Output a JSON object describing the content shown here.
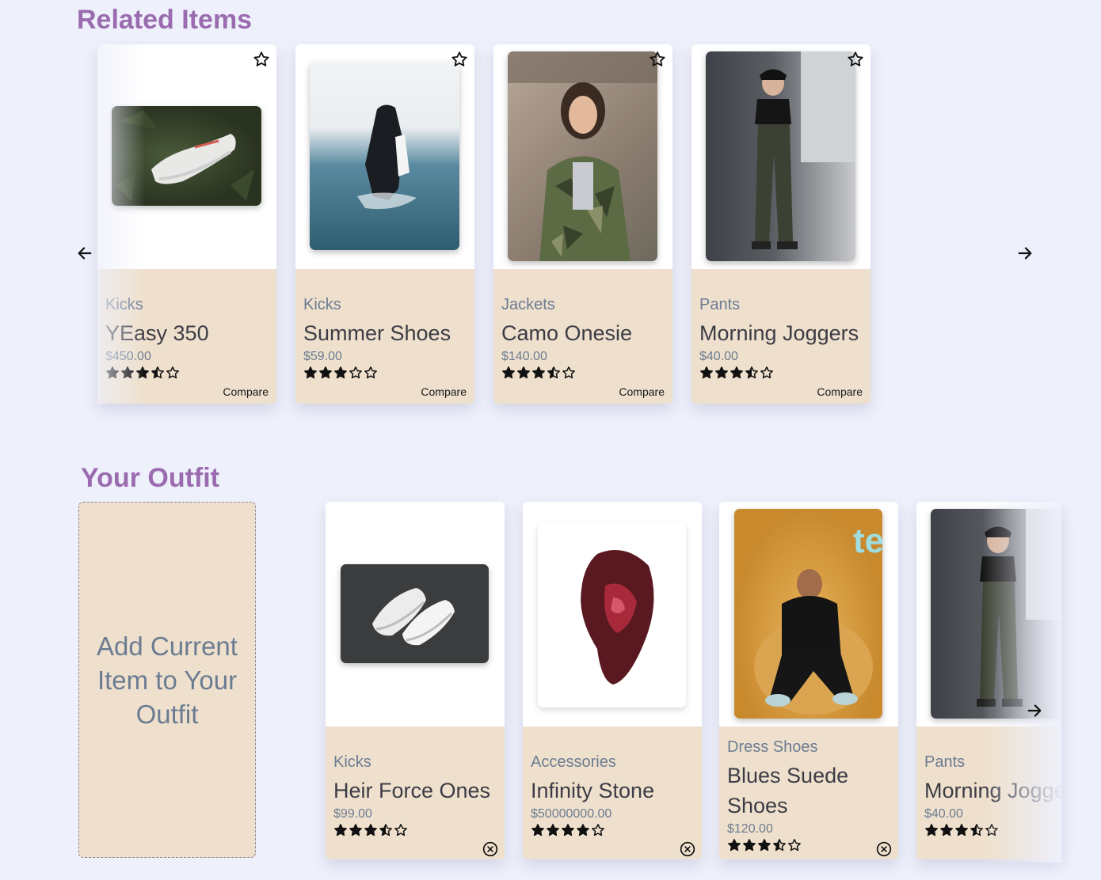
{
  "related": {
    "title": "Related Items",
    "compare_label": "Compare",
    "cards": [
      {
        "category": "Kicks",
        "name": "YEasy 350",
        "price": "$450.00",
        "rating": 3.5,
        "image": "sneaker-image"
      },
      {
        "category": "Kicks",
        "name": "Summer Shoes",
        "price": "$59.00",
        "rating": 3,
        "image": "ocean-wader-image"
      },
      {
        "category": "Jackets",
        "name": "Camo Onesie",
        "price": "$140.00",
        "rating": 3.5,
        "image": "camo-jacket-image"
      },
      {
        "category": "Pants",
        "name": "Morning Joggers",
        "price": "$40.00",
        "rating": 3.5,
        "image": "joggers-image"
      }
    ]
  },
  "outfit": {
    "title": "Your Outfit",
    "add_label": "Add Current Item to Your Outfit",
    "cards": [
      {
        "category": "Kicks",
        "name": "Heir Force Ones",
        "price": "$99.00",
        "rating": 3.5,
        "image": "white-sneakers-image"
      },
      {
        "category": "Accessories",
        "name": "Infinity Stone",
        "price": "$50000000.00",
        "rating": 4,
        "image": "red-gem-image"
      },
      {
        "category": "Dress Shoes",
        "name": "Blues Suede Shoes",
        "price": "$120.00",
        "rating": 3.5,
        "image": "fur-chair-image"
      },
      {
        "category": "Pants",
        "name": "Morning Joggers",
        "price": "$40.00",
        "rating": 3.5,
        "image": "joggers-image"
      }
    ]
  },
  "colors": {
    "accent": "#9b6bb0",
    "card_info": "#eee0cc",
    "background": "#eef0fb"
  },
  "icons": {
    "prev": "arrow-left-icon",
    "next": "arrow-right-icon",
    "favorite": "star-outline-icon",
    "remove": "close-circle-icon"
  }
}
